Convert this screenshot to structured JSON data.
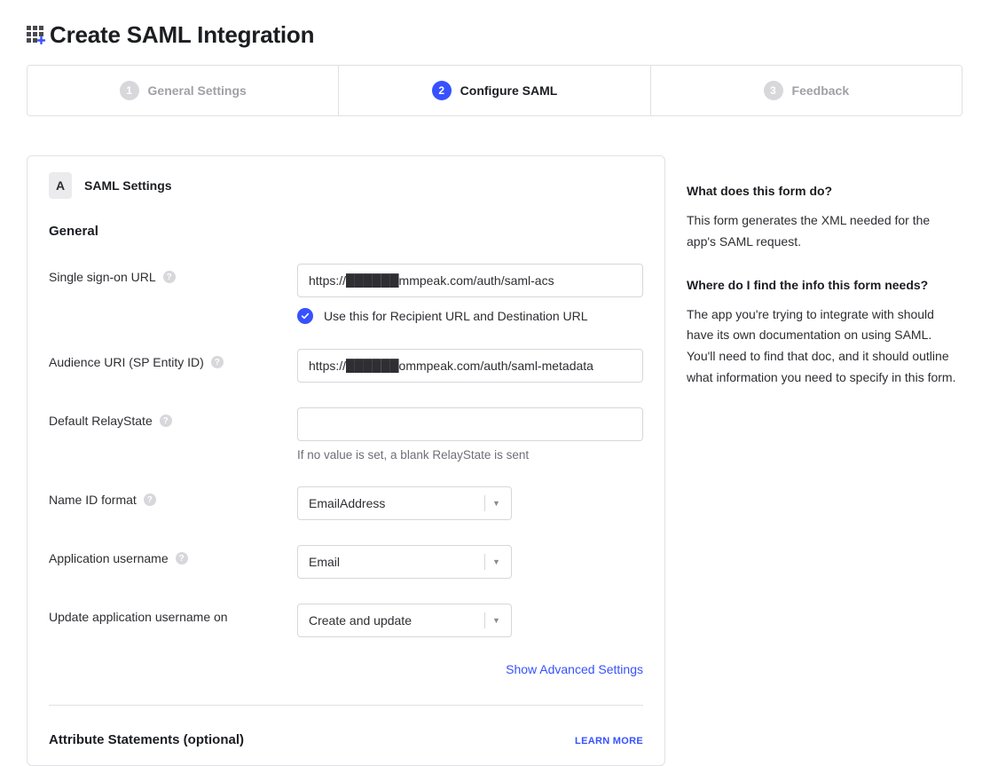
{
  "header": {
    "title": "Create SAML Integration"
  },
  "wizard": {
    "steps": [
      {
        "num": "1",
        "label": "General Settings",
        "active": false
      },
      {
        "num": "2",
        "label": "Configure SAML",
        "active": true
      },
      {
        "num": "3",
        "label": "Feedback",
        "active": false
      }
    ]
  },
  "card": {
    "badge": "A",
    "title": "SAML Settings",
    "general_heading": "General",
    "fields": {
      "sso_url": {
        "label": "Single sign-on URL",
        "value": "https://██████mmpeak.com/auth/saml-acs",
        "checkbox_label": "Use this for Recipient URL and Destination URL"
      },
      "audience_uri": {
        "label": "Audience URI (SP Entity ID)",
        "value": "https://██████ommpeak.com/auth/saml-metadata"
      },
      "relay_state": {
        "label": "Default RelayState",
        "value": "",
        "helper": "If no value is set, a blank RelayState is sent"
      },
      "name_id_format": {
        "label": "Name ID format",
        "value": "EmailAddress"
      },
      "app_username": {
        "label": "Application username",
        "value": "Email"
      },
      "update_on": {
        "label": "Update application username on",
        "value": "Create and update"
      }
    },
    "advanced_link": "Show Advanced Settings",
    "attributes": {
      "title": "Attribute Statements (optional)",
      "learn_more": "LEARN MORE"
    }
  },
  "side": {
    "q1": "What does this form do?",
    "a1": "This form generates the XML needed for the app's SAML request.",
    "q2": "Where do I find the info this form needs?",
    "a2": "The app you're trying to integrate with should have its own documentation on using SAML. You'll need to find that doc, and it should outline what information you need to specify in this form."
  }
}
